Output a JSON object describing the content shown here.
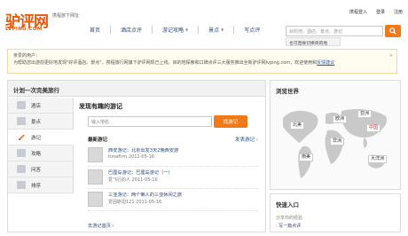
{
  "header": {
    "logo_text": "驴评网",
    "logo_sub": "LVPING.COM",
    "tagline": "携程旅下网址",
    "top_links": [
      "携程登入",
      "登录",
      "注册"
    ]
  },
  "nav": {
    "items": [
      {
        "label": "首页",
        "caret": false
      },
      {
        "label": "酒店点评",
        "caret": false
      },
      {
        "label": "游记攻略",
        "caret": true
      },
      {
        "label": "景点",
        "caret": true
      },
      {
        "label": "写点评",
        "caret": false
      }
    ]
  },
  "search": {
    "placeholder": "目的地、酒店、景点、游记",
    "tip": "也可直接切换目的地"
  },
  "notice": {
    "line1": "亲爱的用户：",
    "line2": "为帮助您出游前更好地发现\"好评酒店、景点\"，携程旅行网旗下驴评网现已上线，目的地探索和口碑点评三大服务推出全新驴评网lvping.com，欢迎使用和",
    "link": "反馈建议",
    "close": "×"
  },
  "left_panel": {
    "title": "计划一次完美旅行",
    "tabs": [
      {
        "label": "酒店",
        "icon": "hotel-icon",
        "active": false
      },
      {
        "label": "景点",
        "icon": "attraction-icon",
        "active": false
      },
      {
        "label": "游记",
        "icon": "pencil-icon",
        "active": true
      },
      {
        "label": "攻略",
        "icon": "guide-icon",
        "active": false
      },
      {
        "label": "问答",
        "icon": "question-icon",
        "active": false
      },
      {
        "label": "排序",
        "icon": "ranking-icon",
        "active": false
      }
    ],
    "content": {
      "title": "发现有趣的游记",
      "input_placeholder": "输入地名",
      "button": "找游记",
      "latest_label": "最新游记",
      "post_label": "发表游记 ›",
      "notes": [
        {
          "title": "西安游记：北京出发3天2晚西安游",
          "meta": "timefirm  2011-05-16"
        },
        {
          "title": "巴厘岛游记：巴厘岛游记（一）",
          "meta": "爱飞行的人  2011-05-16"
        },
        {
          "title": "三亚游记：两个懒人的三亚休闲之旅",
          "meta": "爱因斯坦121  2011-05-16"
        }
      ],
      "more": "去游记首页 ›"
    }
  },
  "world_panel": {
    "title": "浏览世界",
    "continents": [
      "北美",
      "欧洲",
      "亚洲",
      "中国",
      "非洲",
      "南美",
      "大洋洲"
    ]
  },
  "quick_panel": {
    "title": "快速入口",
    "line1": "分享你的经验",
    "line2": "· 写一篇点评"
  },
  "colors": {
    "accent": "#f07a1a",
    "link": "#2a4a7a"
  }
}
